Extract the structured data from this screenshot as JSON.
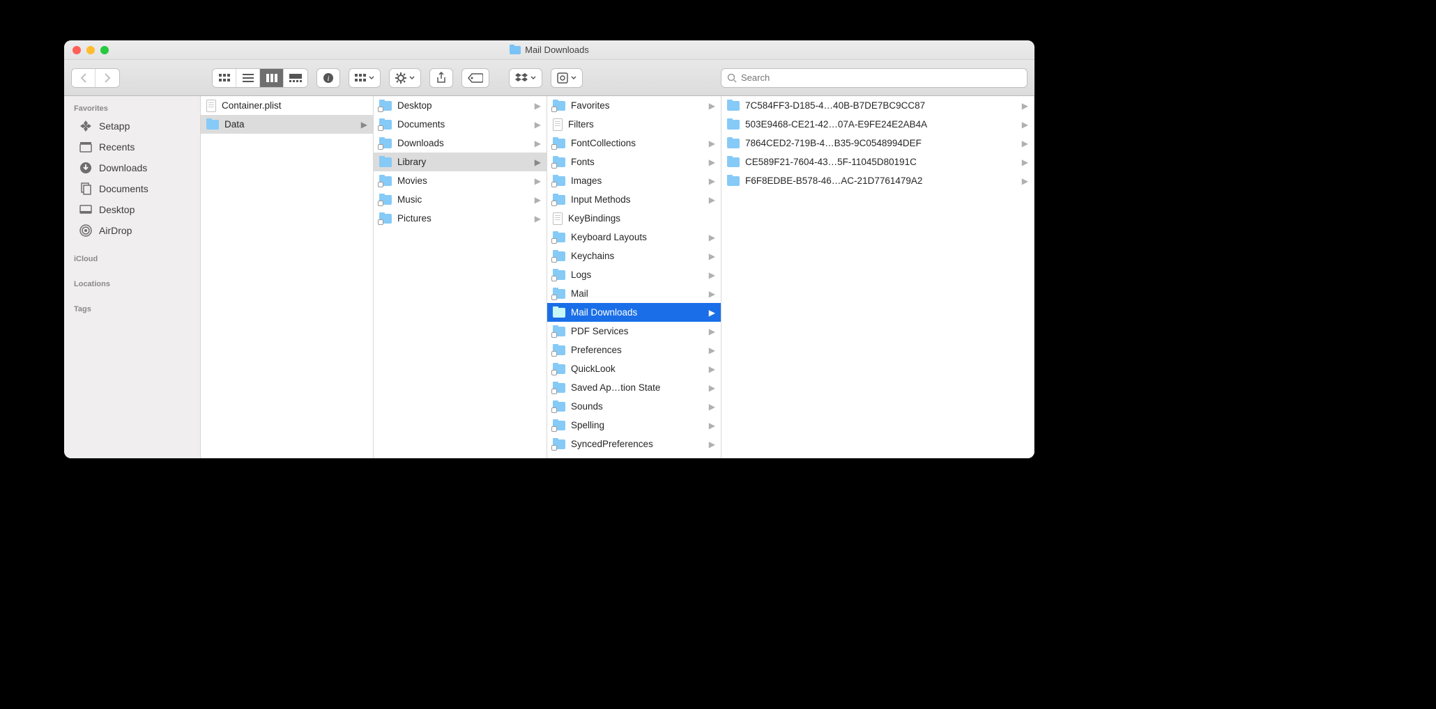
{
  "window": {
    "title": "Mail Downloads"
  },
  "search": {
    "placeholder": "Search"
  },
  "sidebar": {
    "sections": [
      {
        "label": "Favorites",
        "items": [
          {
            "label": "Setapp",
            "icon": "setapp"
          },
          {
            "label": "Recents",
            "icon": "recents"
          },
          {
            "label": "Downloads",
            "icon": "downloads"
          },
          {
            "label": "Documents",
            "icon": "documents"
          },
          {
            "label": "Desktop",
            "icon": "desktop"
          },
          {
            "label": "AirDrop",
            "icon": "airdrop"
          }
        ]
      },
      {
        "label": "iCloud",
        "items": []
      },
      {
        "label": "Locations",
        "items": []
      },
      {
        "label": "Tags",
        "items": []
      }
    ]
  },
  "columns": [
    {
      "items": [
        {
          "name": "Container.plist",
          "kind": "file",
          "hasChildren": false
        },
        {
          "name": "Data",
          "kind": "folder",
          "hasChildren": true,
          "state": "path"
        }
      ]
    },
    {
      "items": [
        {
          "name": "Desktop",
          "kind": "folder-alias",
          "hasChildren": true
        },
        {
          "name": "Documents",
          "kind": "folder-alias",
          "hasChildren": true
        },
        {
          "name": "Downloads",
          "kind": "folder-alias",
          "hasChildren": true
        },
        {
          "name": "Library",
          "kind": "folder",
          "hasChildren": true,
          "state": "path"
        },
        {
          "name": "Movies",
          "kind": "folder-alias",
          "hasChildren": true
        },
        {
          "name": "Music",
          "kind": "folder-alias",
          "hasChildren": true
        },
        {
          "name": "Pictures",
          "kind": "folder-alias",
          "hasChildren": true
        }
      ]
    },
    {
      "items": [
        {
          "name": "Favorites",
          "kind": "folder-alias",
          "hasChildren": true
        },
        {
          "name": "Filters",
          "kind": "file",
          "hasChildren": false
        },
        {
          "name": "FontCollections",
          "kind": "folder-alias",
          "hasChildren": true
        },
        {
          "name": "Fonts",
          "kind": "folder-alias",
          "hasChildren": true
        },
        {
          "name": "Images",
          "kind": "folder-alias",
          "hasChildren": true
        },
        {
          "name": "Input Methods",
          "kind": "folder-alias",
          "hasChildren": true
        },
        {
          "name": "KeyBindings",
          "kind": "file",
          "hasChildren": false
        },
        {
          "name": "Keyboard Layouts",
          "kind": "folder-alias",
          "hasChildren": true
        },
        {
          "name": "Keychains",
          "kind": "folder-alias",
          "hasChildren": true
        },
        {
          "name": "Logs",
          "kind": "folder-alias",
          "hasChildren": true
        },
        {
          "name": "Mail",
          "kind": "folder-alias",
          "hasChildren": true
        },
        {
          "name": "Mail Downloads",
          "kind": "folder",
          "hasChildren": true,
          "state": "active"
        },
        {
          "name": "PDF Services",
          "kind": "folder-alias",
          "hasChildren": true
        },
        {
          "name": "Preferences",
          "kind": "folder-alias",
          "hasChildren": true
        },
        {
          "name": "QuickLook",
          "kind": "folder-alias",
          "hasChildren": true
        },
        {
          "name": "Saved Ap…tion State",
          "kind": "folder-alias",
          "hasChildren": true
        },
        {
          "name": "Sounds",
          "kind": "folder-alias",
          "hasChildren": true
        },
        {
          "name": "Spelling",
          "kind": "folder-alias",
          "hasChildren": true
        },
        {
          "name": "SyncedPreferences",
          "kind": "folder-alias",
          "hasChildren": true
        }
      ]
    },
    {
      "items": [
        {
          "name": "7C584FF3-D185-4…40B-B7DE7BC9CC87",
          "kind": "folder",
          "hasChildren": true
        },
        {
          "name": "503E9468-CE21-42…07A-E9FE24E2AB4A",
          "kind": "folder",
          "hasChildren": true
        },
        {
          "name": "7864CED2-719B-4…B35-9C0548994DEF",
          "kind": "folder",
          "hasChildren": true
        },
        {
          "name": "CE589F21-7604-43…5F-11045D80191C",
          "kind": "folder",
          "hasChildren": true
        },
        {
          "name": "F6F8EDBE-B578-46…AC-21D7761479A2",
          "kind": "folder",
          "hasChildren": true
        }
      ]
    }
  ]
}
